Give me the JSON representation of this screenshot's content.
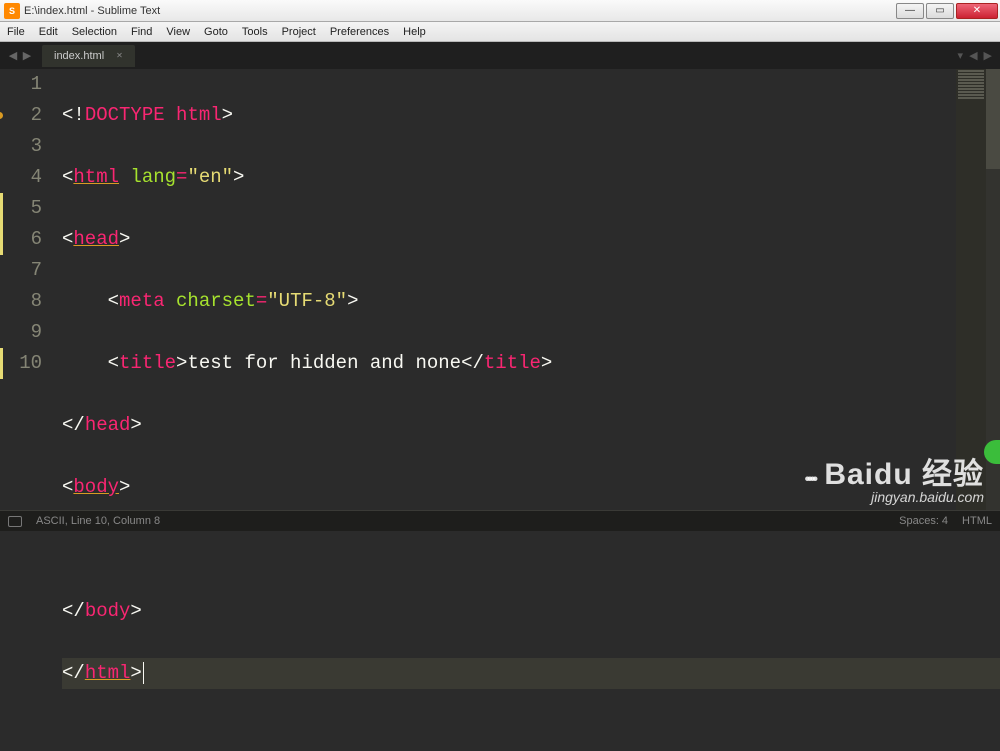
{
  "window": {
    "title": "E:\\index.html - Sublime Text",
    "app_icon_letter": "S"
  },
  "menu": [
    "File",
    "Edit",
    "Selection",
    "Find",
    "View",
    "Goto",
    "Tools",
    "Project",
    "Preferences",
    "Help"
  ],
  "tab": {
    "label": "index.html"
  },
  "gutter": {
    "lines": [
      "1",
      "2",
      "3",
      "4",
      "5",
      "6",
      "7",
      "8",
      "9",
      "10"
    ],
    "marks": [
      2,
      10
    ]
  },
  "code": {
    "l1": {
      "a": "<!",
      "b": "DOCTYPE",
      "sp": " ",
      "c": "html",
      "d": ">"
    },
    "l2": {
      "a": "<",
      "tag": "html",
      "sp": " ",
      "attr": "lang",
      "eq": "=",
      "str": "\"en\"",
      "d": ">"
    },
    "l3": {
      "a": "<",
      "tag": "head",
      "d": ">"
    },
    "l4": {
      "ind": "    ",
      "a": "<",
      "tag": "meta",
      "sp": " ",
      "attr": "charset",
      "eq": "=",
      "str": "\"UTF-8\"",
      "d": ">"
    },
    "l5": {
      "ind": "    ",
      "a": "<",
      "tag": "title",
      "d": ">",
      "txt": "test for hidden and none",
      "a2": "</",
      "tag2": "title",
      "d2": ">"
    },
    "l6": {
      "a": "</",
      "tag": "head",
      "d": ">"
    },
    "l7": {
      "a": "<",
      "tag": "body",
      "d": ">"
    },
    "l8": {
      "blank": ""
    },
    "l9": {
      "a": "</",
      "tag": "body",
      "d": ">"
    },
    "l10": {
      "a": "</",
      "tag": "html",
      "d": ">"
    }
  },
  "status": {
    "path": "ASCII, Line 10, Column 8",
    "spaces": "Spaces: 4",
    "syntax": "HTML"
  },
  "watermark": {
    "brand": "Baidu 经验",
    "url": "jingyan.baidu.com",
    "paws": "••••"
  }
}
